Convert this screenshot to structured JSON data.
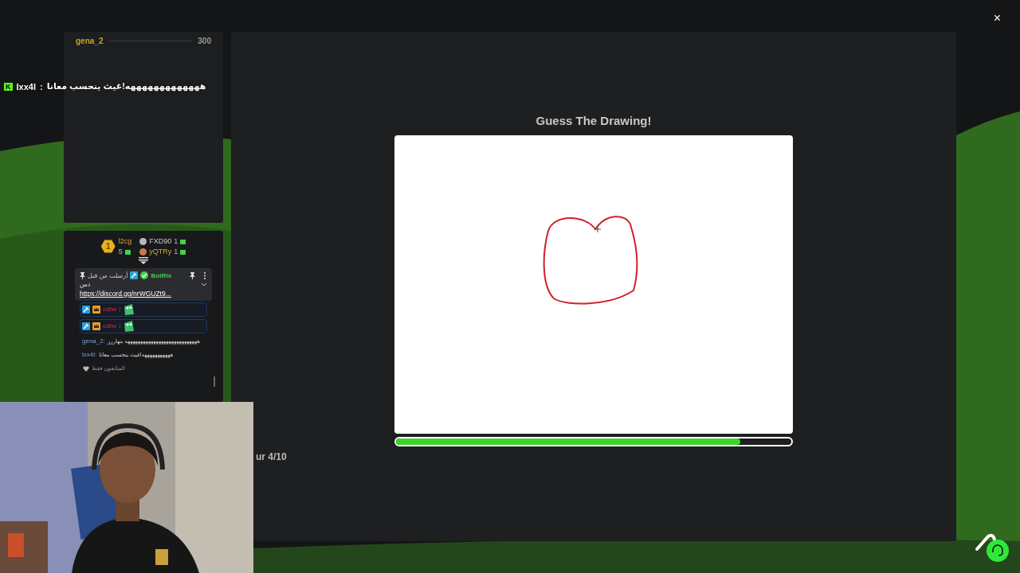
{
  "close_button": "×",
  "leaderboard": {
    "players": [
      {
        "name": "gena_2",
        "score": "300"
      }
    ]
  },
  "overlay_chat": {
    "badge": "K",
    "user": "lxx4l",
    "separator": ":",
    "message": "هههههههههههههه!غيث ينحسب معانا"
  },
  "podium": {
    "first": {
      "rank": "1",
      "name": "l2cg",
      "count": "5"
    },
    "others": [
      {
        "name": "FXD90",
        "count": "1",
        "color": "#b8b8b8"
      },
      {
        "name": "yQTRy",
        "count": "1",
        "color": "#c8794a"
      }
    ]
  },
  "pinned": {
    "label": "أرسلت من قبل",
    "author": "BotRix",
    "message": "دس",
    "link": "https://discord.gg/nrWGUZt9..."
  },
  "chat": [
    {
      "kind": "emote",
      "user": "odhv",
      "separator": ":",
      "highlighted": true
    },
    {
      "kind": "emote",
      "user": "odhv",
      "separator": ":",
      "highlighted": true
    },
    {
      "kind": "text",
      "user": "gena_2:",
      "message": "ههههههههههههههههههههههههههههه بنهاررر",
      "highlighted": false
    },
    {
      "kind": "text",
      "user": "lxx4l:",
      "message": "هههههههههههه!غيث ينحسب معانا",
      "highlighted": false
    }
  ],
  "chat_mode": "المتابعون فقط",
  "game": {
    "title": "Guess The Drawing!",
    "timer": {
      "level": 0.87
    },
    "round": "ur 4/10"
  }
}
